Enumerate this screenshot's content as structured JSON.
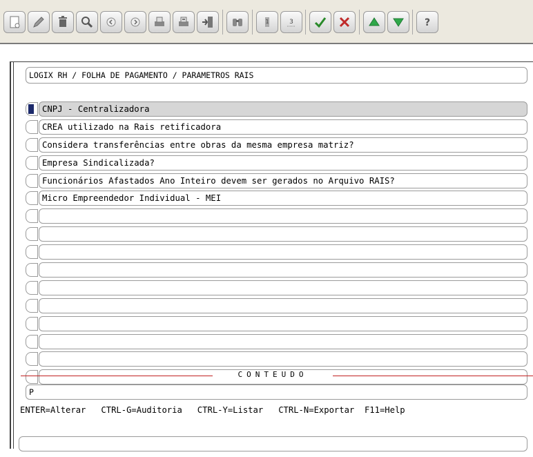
{
  "toolbar": {
    "buttons": [
      {
        "icon": "new-document-icon"
      },
      {
        "icon": "edit-pencil-icon"
      },
      {
        "icon": "trash-icon"
      },
      {
        "icon": "search-magnifier-icon"
      },
      {
        "icon": "previous-icon"
      },
      {
        "icon": "next-icon"
      },
      {
        "icon": "print-icon"
      },
      {
        "icon": "print-all-icon"
      },
      {
        "icon": "exit-icon"
      },
      {
        "icon": "binoculars-icon"
      },
      {
        "icon": "first-record-icon"
      },
      {
        "icon": "last-record-icon"
      },
      {
        "icon": "confirm-check-icon"
      },
      {
        "icon": "cancel-x-icon"
      },
      {
        "icon": "scroll-up-icon"
      },
      {
        "icon": "scroll-down-icon"
      },
      {
        "icon": "help-icon"
      }
    ]
  },
  "title": "LOGIX RH / FOLHA DE PAGAMENTO / PARAMETROS RAIS",
  "list": {
    "items": [
      "CNPJ - Centralizadora",
      "CREA utilizado na Rais retificadora",
      "Considera transferências entre obras da mesma empresa matriz?",
      "Empresa Sindicalizada?",
      "Funcionários Afastados Ano Inteiro devem ser gerados no Arquivo RAIS?",
      "Micro Empreendedor Individual - MEI",
      "",
      "",
      "",
      "",
      "",
      "",
      "",
      "",
      "",
      ""
    ],
    "selected_index": 0
  },
  "section_label": "CONTEUDO",
  "content_value": "P",
  "hotkeys": "ENTER=Alterar   CTRL-G=Auditoria   CTRL-Y=Listar   CTRL-N=Exportar  F11=Help",
  "status_text": ""
}
